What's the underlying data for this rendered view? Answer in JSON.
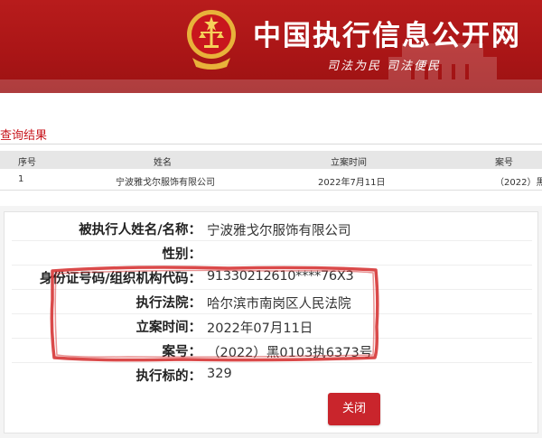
{
  "header": {
    "site_title": "中国执行信息公开网",
    "slogan": "司法为民  司法便民",
    "brand_color": "#b81c1c"
  },
  "results": {
    "title": "查询结果",
    "columns": [
      "序号",
      "姓名",
      "立案时间",
      "案号"
    ],
    "rows": [
      {
        "index": "1",
        "name": "宁波雅戈尔服饰有限公司",
        "date": "2022年7月11日",
        "case_no": "（2022）黑"
      }
    ]
  },
  "detail": {
    "fields": [
      {
        "label": "被执行人姓名/名称：",
        "value": "宁波雅戈尔服饰有限公司"
      },
      {
        "label": "性别：",
        "value": ""
      },
      {
        "label": "身份证号码/组织机构代码：",
        "value": "91330212610****76X3"
      },
      {
        "label": "执行法院：",
        "value": "哈尔滨市南岗区人民法院"
      },
      {
        "label": "立案时间：",
        "value": "2022年07月11日"
      },
      {
        "label": "案号：",
        "value": "（2022）黑0103执6373号"
      },
      {
        "label": "执行标的：",
        "value": "329"
      }
    ],
    "close_label": "关闭",
    "highlight_color": "#d42a2a"
  }
}
